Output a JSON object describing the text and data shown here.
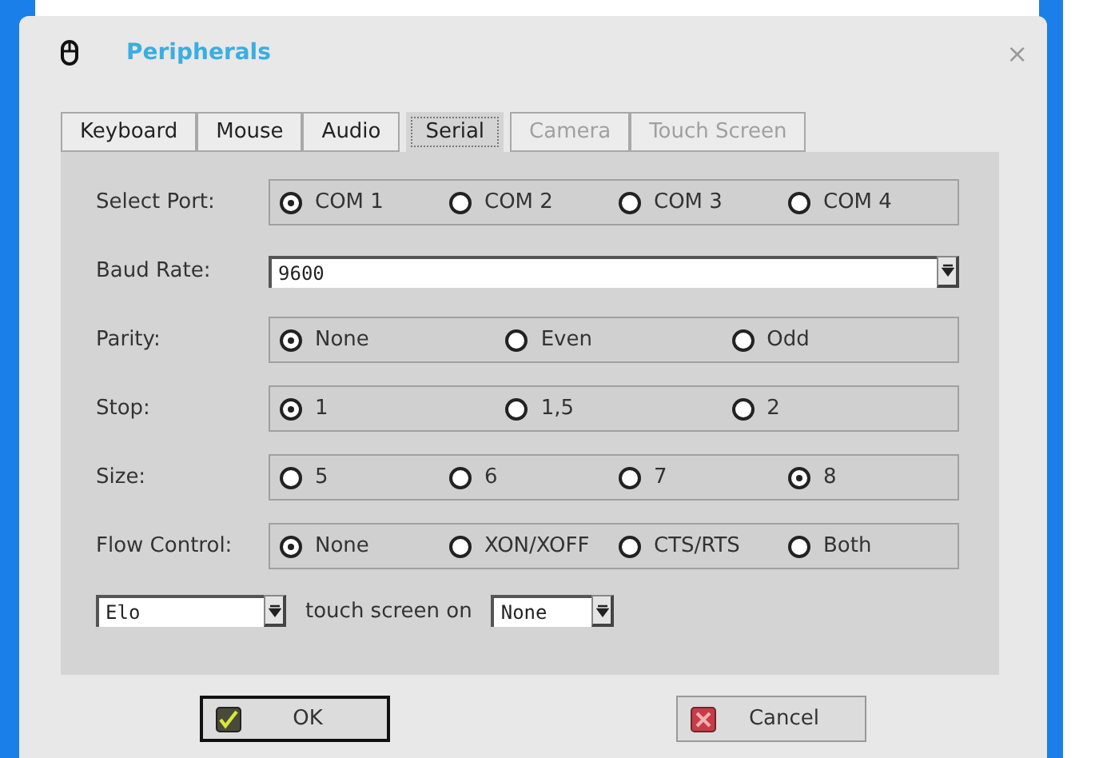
{
  "window": {
    "title": "Peripherals",
    "close": "×"
  },
  "tabs": [
    {
      "label": "Keyboard",
      "selected": false,
      "disabled": false
    },
    {
      "label": "Mouse",
      "selected": false,
      "disabled": false
    },
    {
      "label": "Audio",
      "selected": false,
      "disabled": false
    },
    {
      "label": "Serial",
      "selected": true,
      "disabled": false
    },
    {
      "label": "Camera",
      "selected": false,
      "disabled": true
    },
    {
      "label": "Touch Screen",
      "selected": false,
      "disabled": true
    }
  ],
  "rows": [
    {
      "kind": "radio",
      "label": "Select Port:",
      "options": [
        {
          "label": "COM 1",
          "selected": true
        },
        {
          "label": "COM 2",
          "selected": false
        },
        {
          "label": "COM 3",
          "selected": false
        },
        {
          "label": "COM 4",
          "selected": false
        }
      ]
    },
    {
      "kind": "combo",
      "label": "Baud Rate:",
      "value": "9600"
    },
    {
      "kind": "radio",
      "label": "Parity:",
      "options": [
        {
          "label": "None",
          "selected": true
        },
        {
          "label": "Even",
          "selected": false
        },
        {
          "label": "Odd",
          "selected": false
        }
      ]
    },
    {
      "kind": "radio",
      "label": "Stop:",
      "options": [
        {
          "label": "1",
          "selected": true
        },
        {
          "label": "1,5",
          "selected": false
        },
        {
          "label": "2",
          "selected": false
        }
      ]
    },
    {
      "kind": "radio",
      "label": "Size:",
      "options": [
        {
          "label": "5",
          "selected": false
        },
        {
          "label": "6",
          "selected": false
        },
        {
          "label": "7",
          "selected": false
        },
        {
          "label": "8",
          "selected": true
        }
      ]
    },
    {
      "kind": "radio",
      "label": "Flow Control:",
      "options": [
        {
          "label": "None",
          "selected": true
        },
        {
          "label": "XON/XOFF",
          "selected": false
        },
        {
          "label": "CTS/RTS",
          "selected": false
        },
        {
          "label": "Both",
          "selected": false
        }
      ]
    }
  ],
  "touch": {
    "device": "Elo",
    "text": "touch screen on",
    "port": "None"
  },
  "buttons": [
    {
      "kind": "ok",
      "label": "OK"
    },
    {
      "kind": "cancel",
      "label": "Cancel"
    }
  ]
}
